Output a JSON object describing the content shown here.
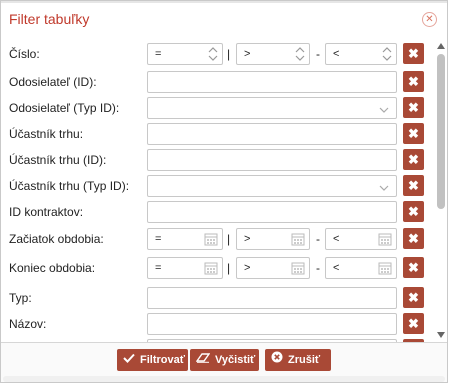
{
  "dialog": {
    "title": "Filter tabuľky",
    "close_icon": "close-circle-icon"
  },
  "rows": {
    "cislo": {
      "label": "Číslo:",
      "op_eq": "=",
      "op_gt": ">",
      "op_lt": "<",
      "sep1": "|",
      "sep2": "-"
    },
    "odosielatel_id": {
      "label": "Odosielateľ (ID):",
      "value": ""
    },
    "odosielatel_typ": {
      "label": "Odosielateľ (Typ ID):",
      "value": ""
    },
    "ucastnik": {
      "label": "Účastník trhu:",
      "value": ""
    },
    "ucastnik_id": {
      "label": "Účastník trhu (ID):",
      "value": ""
    },
    "ucastnik_typ": {
      "label": "Účastník trhu (Typ ID):",
      "value": ""
    },
    "id_kontraktov": {
      "label": "ID kontraktov:",
      "value": ""
    },
    "zaciatok": {
      "label": "Začiatok obdobia:",
      "op_eq": "=",
      "op_gt": ">",
      "op_lt": "<",
      "sep1": "|",
      "sep2": "-"
    },
    "koniec": {
      "label": "Koniec obdobia:",
      "op_eq": "=",
      "op_gt": ">",
      "op_lt": "<",
      "sep1": "|",
      "sep2": "-"
    },
    "typ": {
      "label": "Typ:",
      "value": ""
    },
    "nazov": {
      "label": "Názov:",
      "value": ""
    }
  },
  "clear_glyph": "✖",
  "footer": {
    "filter_label": "Filtrovať",
    "clear_label": "Vyčistiť",
    "cancel_label": "Zrušiť",
    "filter_icon": "check-icon",
    "clear_icon": "eraser-icon",
    "cancel_icon": "cancel-circle-icon"
  },
  "colors": {
    "accent": "#a94936",
    "title": "#c0392b",
    "border": "#c8c8c8"
  }
}
